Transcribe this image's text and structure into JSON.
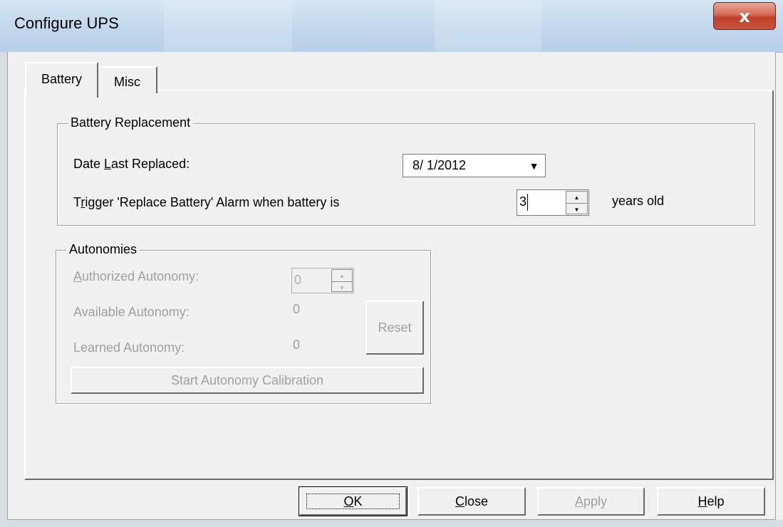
{
  "window": {
    "title": "Configure UPS",
    "close_glyph": "x"
  },
  "tabs": [
    {
      "label": "Battery",
      "selected": true
    },
    {
      "label": "Misc",
      "selected": false
    }
  ],
  "battery_replacement": {
    "group_label": "Battery Replacement",
    "date_label_pre": "Date ",
    "date_label_accel": "L",
    "date_label_post": "ast Replaced:",
    "date_value": "8/ 1/2012",
    "trigger_label_pre": "T",
    "trigger_label_accel": "r",
    "trigger_label_post": "igger 'Replace Battery' Alarm when battery is",
    "years_value": "3",
    "years_suffix": "years old"
  },
  "autonomies": {
    "group_label": "Autonomies",
    "authorized_label_accel": "A",
    "authorized_label_post": "uthorized Autonomy:",
    "authorized_value": "0",
    "available_label": "Available Autonomy:",
    "available_value": "0",
    "learned_label": "Learned Autonomy:",
    "learned_value": "0",
    "reset_label": "Reset",
    "calibration_label": "Start Autonomy Calibration"
  },
  "buttons": {
    "ok_accel": "O",
    "ok_post": "K",
    "close_accel": "C",
    "close_post": "lose",
    "apply_accel": "A",
    "apply_post": "pply",
    "help_accel": "H",
    "help_post": "elp"
  },
  "icons": {
    "dropdown": "▼",
    "spin_up": "▲",
    "spin_down": "▼"
  }
}
